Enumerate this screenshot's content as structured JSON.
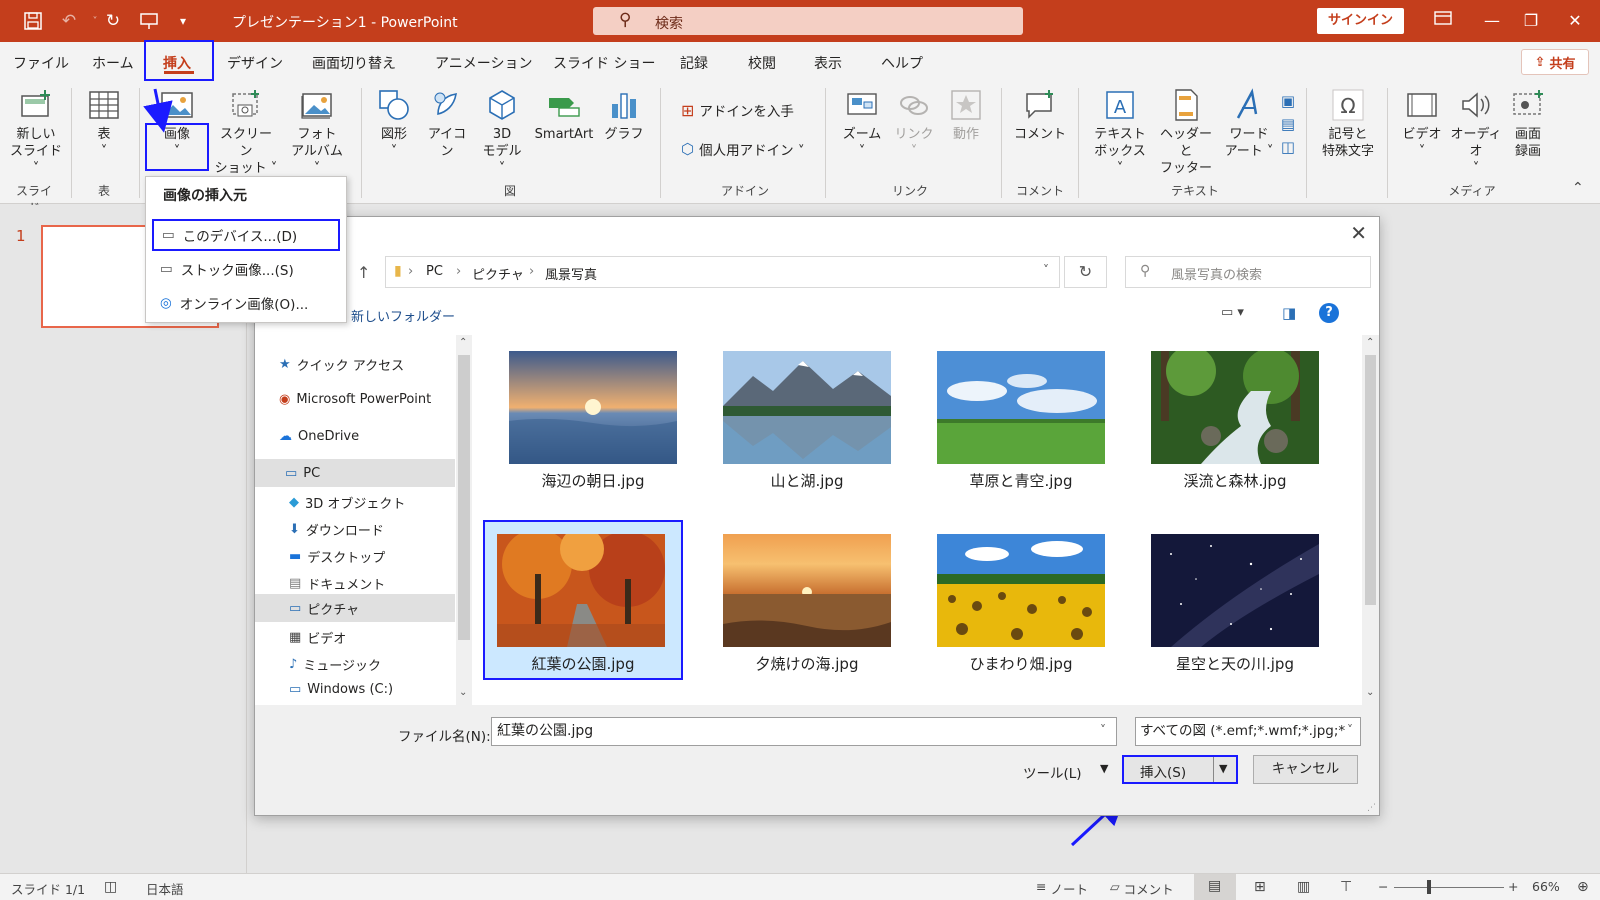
{
  "titlebar": {
    "title": "プレゼンテーション1  -  PowerPoint",
    "search_placeholder": "検索",
    "signin": "サインイン"
  },
  "tabs": [
    "ファイル",
    "ホーム",
    "挿入",
    "デザイン",
    "画面切り替え",
    "アニメーション",
    "スライド ショー",
    "記録",
    "校閲",
    "表示",
    "ヘルプ"
  ],
  "share": "共有",
  "ribbon": {
    "new_slide": "新しい\nスライド ˅",
    "table": "表\n˅",
    "image": "画像\n˅",
    "screenshot": "スクリーン\nショット ˅",
    "photo_album": "フォト\nアルバム ˅",
    "shapes": "図形\n˅",
    "icons": "アイコン",
    "model3d": "3D\nモデル ˅",
    "smartart": "SmartArt",
    "chart": "グラフ",
    "get_addins": "アドインを入手",
    "my_addins": "個人用アドイン ˅",
    "zoom": "ズーム\n˅",
    "link": "リンク\n˅",
    "action": "動作",
    "comment": "コメント",
    "textbox": "テキスト\nボックス ˅",
    "header_footer": "ヘッダーと\nフッター",
    "wordart": "ワード\nアート ˅",
    "symbols": "記号と\n特殊文字",
    "video": "ビデオ\n˅",
    "audio": "オーディオ\n˅",
    "screen_record": "画面\n録画",
    "groups": {
      "slides": "スライド",
      "tables": "表",
      "images": "図",
      "addins": "アドイン",
      "links": "リンク",
      "comments": "コメント",
      "text": "テキスト",
      "media": "メディア"
    }
  },
  "slide_pane": {
    "number": "1"
  },
  "dropdown": {
    "header": "画像の挿入元",
    "items": [
      "このデバイス...(D)",
      "ストック画像...(S)",
      "オンライン画像(O)..."
    ]
  },
  "dialog": {
    "breadcrumb": [
      "PC",
      "ピクチャ",
      "風景写真"
    ],
    "search_placeholder": "風景写真の検索",
    "new_folder": "新しいフォルダー",
    "nav": [
      "クイック アクセス",
      "Microsoft PowerPoint",
      "OneDrive",
      "PC",
      "3D オブジェクト",
      "ダウンロード",
      "デスクトップ",
      "ドキュメント",
      "ピクチャ",
      "ビデオ",
      "ミュージック",
      "Windows (C:)"
    ],
    "files": [
      "海辺の朝日.jpg",
      "山と湖.jpg",
      "草原と青空.jpg",
      "渓流と森林.jpg",
      "紅葉の公園.jpg",
      "夕焼けの海.jpg",
      "ひまわり畑.jpg",
      "星空と天の川.jpg"
    ],
    "filename_label": "ファイル名(N):",
    "filename_value": "紅葉の公園.jpg",
    "filter": "すべての図 (*.emf;*.wmf;*.jpg;*",
    "tools": "ツール(L)",
    "insert": "挿入(S)",
    "cancel": "キャンセル"
  },
  "statusbar": {
    "slide": "スライド 1/1",
    "language": "日本語",
    "notes": "ノート",
    "comments": "コメント",
    "zoom": "66%"
  },
  "colors": {
    "accent": "#c43e1c",
    "highlight": "#1a1aff"
  }
}
